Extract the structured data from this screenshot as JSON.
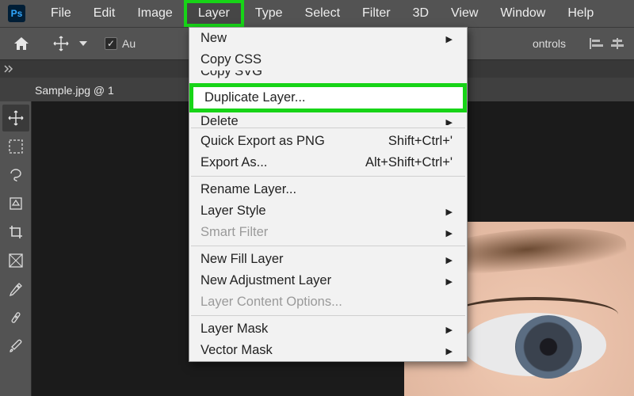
{
  "app": {
    "logo_text": "Ps"
  },
  "menubar": {
    "items": [
      "File",
      "Edit",
      "Image",
      "Layer",
      "Type",
      "Select",
      "Filter",
      "3D",
      "View",
      "Window",
      "Help"
    ],
    "highlighted_index": 3
  },
  "options_bar": {
    "auto_label": "Au",
    "controls_label": "ontrols"
  },
  "document": {
    "tab_label": "Sample.jpg @ 1"
  },
  "dropdown": {
    "items": [
      {
        "label": "New",
        "submenu": true
      },
      {
        "label": "Copy CSS"
      },
      {
        "label": "Copy SVG",
        "truncated": "top"
      },
      {
        "label": "Duplicate Layer...",
        "highlighted": true
      },
      {
        "label": "Delete",
        "submenu": true,
        "truncated": "bottom"
      },
      {
        "sep": true
      },
      {
        "label": "Quick Export as PNG",
        "shortcut": "Shift+Ctrl+'"
      },
      {
        "label": "Export As...",
        "shortcut": "Alt+Shift+Ctrl+'"
      },
      {
        "sep": true
      },
      {
        "label": "Rename Layer..."
      },
      {
        "label": "Layer Style",
        "submenu": true
      },
      {
        "label": "Smart Filter",
        "submenu": true,
        "disabled": true
      },
      {
        "sep": true
      },
      {
        "label": "New Fill Layer",
        "submenu": true
      },
      {
        "label": "New Adjustment Layer",
        "submenu": true
      },
      {
        "label": "Layer Content Options...",
        "disabled": true
      },
      {
        "sep": true
      },
      {
        "label": "Layer Mask",
        "submenu": true
      },
      {
        "label": "Vector Mask",
        "submenu": true
      }
    ]
  },
  "tools": [
    "move",
    "marquee",
    "lasso",
    "wand",
    "crop",
    "frame",
    "eyedrop",
    "brush",
    "heal"
  ]
}
